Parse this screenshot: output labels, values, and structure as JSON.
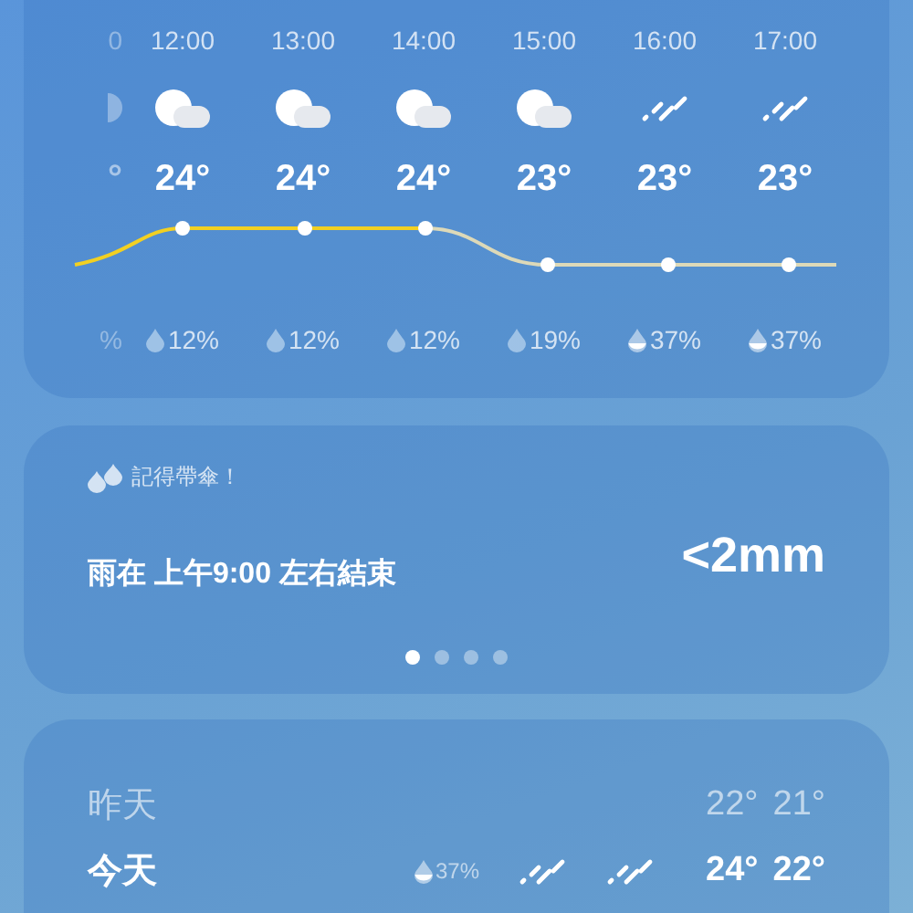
{
  "hourly": [
    {
      "time": "0",
      "kind": "partial",
      "temp": "°",
      "pop": "%"
    },
    {
      "time": "12:00",
      "kind": "cloudy",
      "temp": "24°",
      "pop": "12%"
    },
    {
      "time": "13:00",
      "kind": "cloudy",
      "temp": "24°",
      "pop": "12%"
    },
    {
      "time": "14:00",
      "kind": "cloudy",
      "temp": "24°",
      "pop": "12%"
    },
    {
      "time": "15:00",
      "kind": "cloudy",
      "temp": "23°",
      "pop": "19%"
    },
    {
      "time": "16:00",
      "kind": "rain",
      "temp": "23°",
      "pop": "37%"
    },
    {
      "time": "17:00",
      "kind": "rain",
      "temp": "23°",
      "pop": "37%"
    }
  ],
  "precip_card": {
    "header": "記得帶傘！",
    "message": "雨在 上午9:00 左右結束",
    "amount": "<2mm",
    "pages": [
      {
        "selected": true
      },
      {
        "selected": false
      },
      {
        "selected": false
      },
      {
        "selected": false
      }
    ]
  },
  "daily": [
    {
      "day": "昨天",
      "past": true,
      "high": "22°",
      "low": "21°"
    },
    {
      "day": "今天",
      "past": false,
      "pop": "37%",
      "conditions": [
        {
          "kind": "rain"
        },
        {
          "kind": "rain"
        }
      ],
      "high": "24°",
      "low": "22°"
    }
  ]
}
